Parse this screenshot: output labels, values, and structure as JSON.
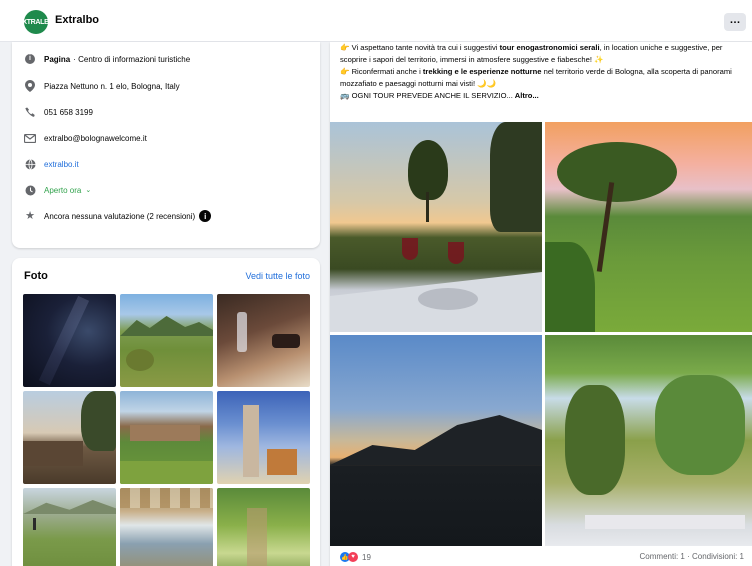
{
  "header": {
    "page_name": "Extralbo",
    "logo_text": "EXTRALBO",
    "more_label": "…"
  },
  "info": {
    "category_label": "Pagina",
    "category_value": "· Centro di informazioni turistiche",
    "address": "Piazza Nettuno n. 1 elo, Bologna, Italy",
    "phone": "051 658 3199",
    "email": "extralbo@bolognawelcome.it",
    "website": "extralbo.it",
    "hours": "Aperto ora",
    "rating": "Ancora nessuna valutazione (2 recensioni)",
    "rating_badge": "i"
  },
  "photos": {
    "title": "Foto",
    "see_all": "Vedi tutte le foto"
  },
  "post": {
    "line1_a": "👉 Vi aspettano tante novità tra cui i suggestivi ",
    "line1_b": "tour enogastronomici serali",
    "line1_c": ", in location uniche e suggestive, per scoprire i sapori del territorio, immersi in atmosfere suggestive e fiabesche! ✨",
    "line2_a": "👉 Riconfermati anche i ",
    "line2_b": "trekking e le esperienze notturne",
    "line2_c": " nel territorio verde di Bologna, alla scoperta di panorami mozzafiato e paesaggi notturni mai visti! 🌙🌙",
    "line3": "🚌 OGNI TOUR PREVEDE ANCHE IL SERVIZIO...",
    "more_label": " Altro..."
  },
  "footer": {
    "reactions_count": "19",
    "stats": "Commenti: 1 · Condivisioni: 1"
  },
  "icons": [
    "info-icon",
    "pin-icon",
    "phone-icon",
    "email-icon",
    "globe-icon",
    "clock-icon",
    "star-icon",
    "like-reaction-icon",
    "love-reaction-icon"
  ],
  "colors": {
    "accent": "#216fdb",
    "open_green": "#31a24c",
    "logo_green": "#1f8a4c"
  }
}
